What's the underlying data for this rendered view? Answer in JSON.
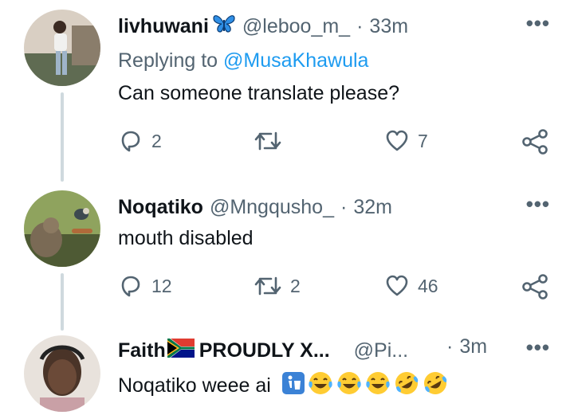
{
  "tweets": [
    {
      "name": "livhuwani",
      "handle": "@leboo_m_",
      "time": "33m",
      "replying_prefix": "Replying to ",
      "replying_to": "@MusaKhawula",
      "text": "Can someone translate please?",
      "replies": "2",
      "retweets": "",
      "likes": "7"
    },
    {
      "name": "Noqatiko",
      "handle": "@Mngqusho_",
      "time": "32m",
      "text": "mouth disabled",
      "replies": "12",
      "retweets": "2",
      "likes": "46"
    },
    {
      "name": "Faith",
      "name_suffix": "PROUDLY X...",
      "handle": "@Pi...",
      "time": "3m",
      "text": "Noqatiko weee ai"
    }
  ],
  "icons": {
    "butterfly": "butterfly-emoji",
    "flag": "south-africa-flag",
    "more": "more-icon",
    "reply": "reply-icon",
    "retweet": "retweet-icon",
    "like": "like-icon",
    "share": "share-icon"
  },
  "colors": {
    "link": "#1d9bf0",
    "secondary": "#536471",
    "thread_line": "#cfd9de"
  }
}
